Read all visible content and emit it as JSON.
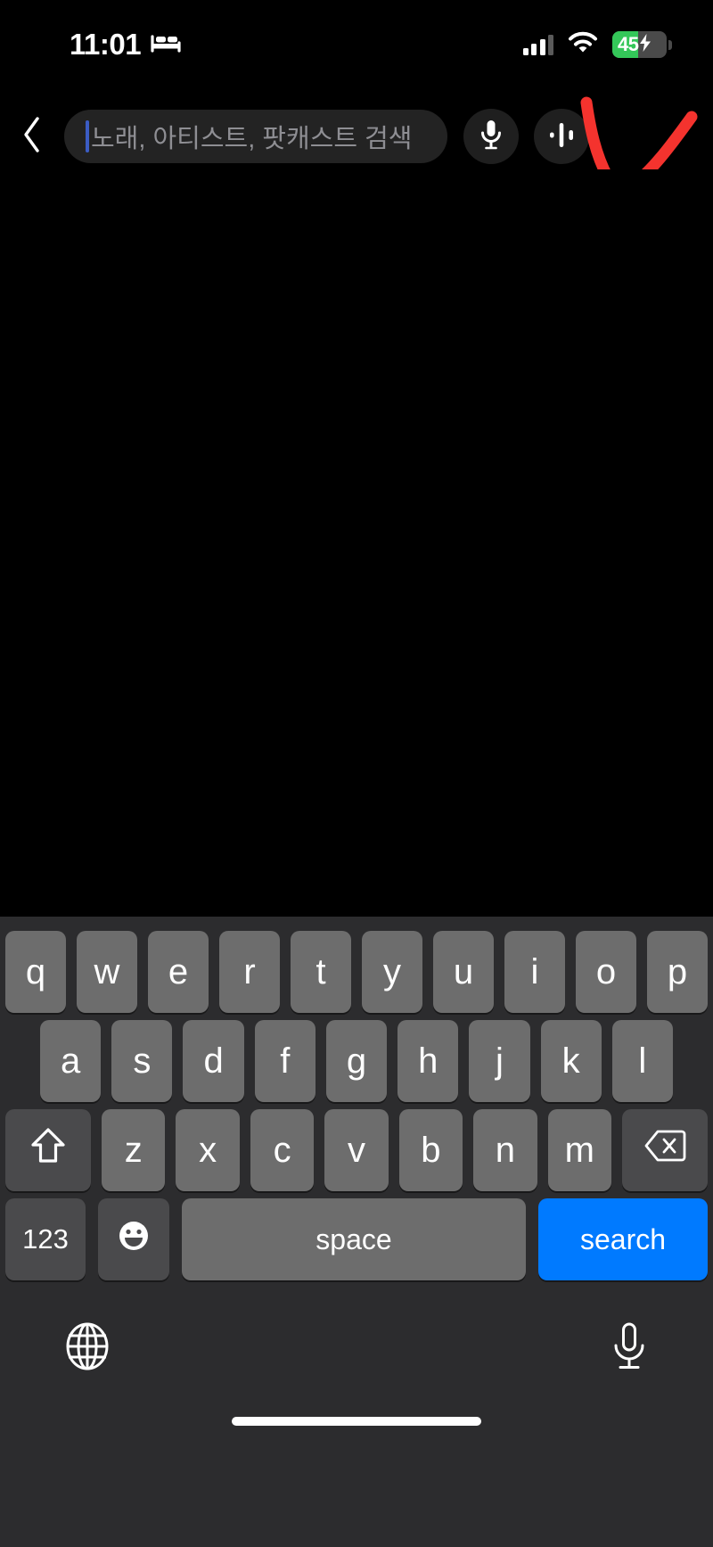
{
  "status_bar": {
    "time": "11:01",
    "focus_icon": "bed-icon",
    "cellular_icon": "cellular-signal-icon",
    "wifi_icon": "wifi-icon",
    "battery_level": "45",
    "battery_charging": true,
    "battery_fill_color": "#34c759"
  },
  "header": {
    "back_icon": "chevron-left-icon",
    "search": {
      "placeholder": "노래, 아티스트, 팟캐스트 검색",
      "value": "",
      "caret_color": "#3b5cc4"
    },
    "voice_button_icon": "microphone-icon",
    "listen_button_icon": "sound-recognition-icon"
  },
  "annotation": {
    "color": "#f4332e",
    "shape": "hand-drawn-check-mark"
  },
  "keyboard": {
    "accent_color": "#007aff",
    "row1": [
      "q",
      "w",
      "e",
      "r",
      "t",
      "y",
      "u",
      "i",
      "o",
      "p"
    ],
    "row2": [
      "a",
      "s",
      "d",
      "f",
      "g",
      "h",
      "j",
      "k",
      "l"
    ],
    "row3": [
      "z",
      "x",
      "c",
      "v",
      "b",
      "n",
      "m"
    ],
    "shift_icon": "shift-arrow-icon",
    "backspace_icon": "backspace-icon",
    "numbers_label": "123",
    "emoji_icon": "emoji-smiley-icon",
    "space_label": "space",
    "return_label": "search",
    "globe_icon": "globe-icon",
    "dictation_icon": "microphone-icon"
  }
}
